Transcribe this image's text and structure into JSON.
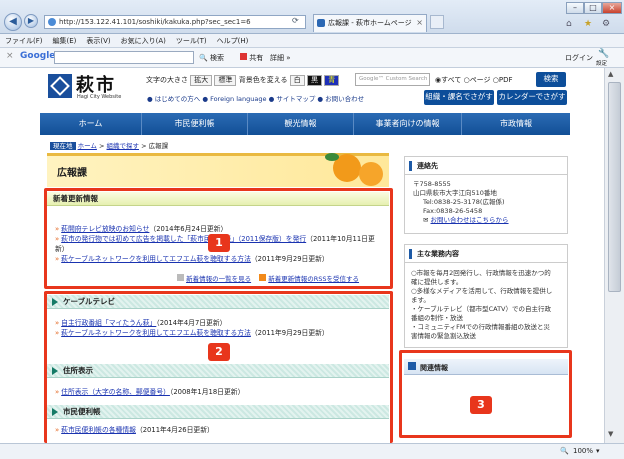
{
  "browser": {
    "address": "http://153.122.41.101/soshiki/kakuka.php?sec_sec1=6",
    "tab_title": "広報課 - 萩市ホームページ",
    "menu": [
      "ファイル(F)",
      "編集(E)",
      "表示(V)",
      "お気に入り(A)",
      "ツール(T)",
      "ヘルプ(H)"
    ],
    "google_label": "Google",
    "search_label": "検索",
    "share_label": "共有",
    "detail_label": "詳細",
    "login_label": "ログイン",
    "settings_label": "設定",
    "zoom": "100%"
  },
  "site": {
    "logo_kanji": "萩市",
    "logo_sub": "Hagi City Website",
    "font_size_label": "文字の大きさ",
    "enlarge": "拡大",
    "standard": "標準",
    "bg_color_label": "背景色を変える",
    "bg_white": "白",
    "bg_black": "黒",
    "bg_blue": "青",
    "search_placeholder": "Google™ Custom Search",
    "radio_all": "すべて",
    "radio_page": "ページ",
    "radio_pdf": "PDF",
    "search_button": "検索",
    "links": [
      "はじめての方へ",
      "Foreign language",
      "サイトマップ",
      "お問い合わせ"
    ],
    "org_search": "組織・課名でさがす",
    "calendar_search": "カレンダーでさがす"
  },
  "nav": [
    "ホーム",
    "市民便利帳",
    "観光情報",
    "事業者向けの情報",
    "市政情報"
  ],
  "breadcrumb": {
    "label": "現在地",
    "home": "ホーム",
    "sep": ">",
    "org": "組織で探す",
    "current": "広報課"
  },
  "page_title": "広報課",
  "news": {
    "heading": "新着更新情報",
    "items": [
      {
        "link": "萩開府テレビ放映のお知らせ",
        "date": "（2014年6月24日更新）"
      },
      {
        "link": "萩市の発行物では初めて広告を掲載した「萩市民便利帳」（2011保存版）を発行",
        "date": "（2011年10月11日更新）"
      },
      {
        "link": "萩ケーブルネットワークを利用してエフエム萩を聴取する方法",
        "date": "（2011年9月29日更新）"
      }
    ],
    "list_link": "新着情報の一覧を見る",
    "rss_link": "新着更新情報のRSSを受信する"
  },
  "sections": [
    {
      "title": "ケーブルテレビ",
      "items": [
        {
          "link": "自主行政番組「マイたうん萩」",
          "date": "（2014年4月7日更新）"
        },
        {
          "link": "萩ケーブルネットワークを利用してエフエム萩を聴取する方法",
          "date": "（2011年9月29日更新）"
        }
      ]
    },
    {
      "title": "住所表示",
      "items": [
        {
          "link": "住所表示（大字の名称、郵便番号）",
          "date": "（2008年1月18日更新）"
        }
      ]
    },
    {
      "title": "市民便利帳",
      "items": [
        {
          "link": "萩市民便利帳の各種情報",
          "date": "（2011年4月26日更新）"
        }
      ]
    }
  ],
  "contact": {
    "heading": "連絡先",
    "zip": "〒758-8555",
    "address": "山口県萩市大字江向510番地",
    "tel": "Tel:0838-25-3178(広報係)",
    "fax": "Fax:0838-26-5458",
    "mail": "お問い合わせはこちらから"
  },
  "duties": {
    "heading": "主な業務内容",
    "lines": [
      "○市報を毎月2回発行し、行政情報を迅速かつ的",
      "確に提供します。",
      "○多様なメディアを活用して、行政情報を提供し",
      "ます。",
      "・ケーブルテレビ（都市型CATV）での自主行政",
      "番組の制作・放送",
      "・コミュニティFMでの行政情報番組の放送と災",
      "害情報の緊急割込放送"
    ]
  },
  "related": {
    "heading": "関連情報"
  },
  "badges": [
    "1",
    "2",
    "3"
  ],
  "colors": {
    "accent_red": "#e8361c",
    "nav_blue": "#124f96"
  }
}
